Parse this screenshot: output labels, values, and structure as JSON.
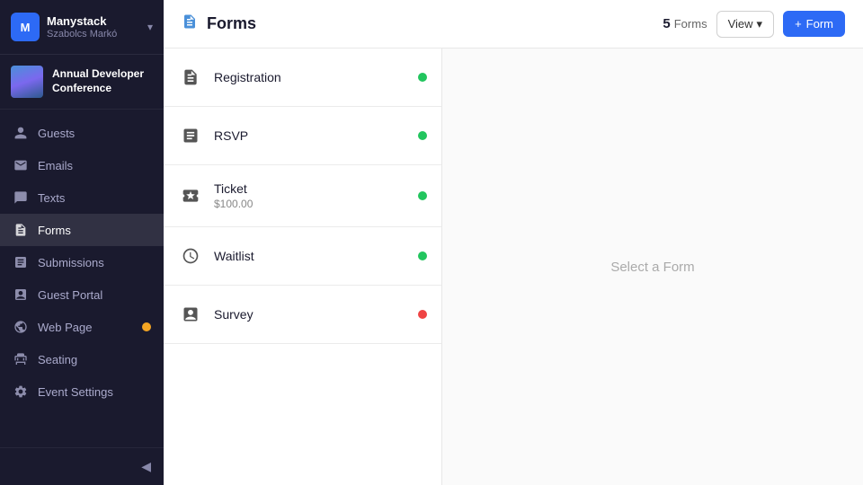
{
  "app": {
    "name": "Manystack",
    "user": "Szabolcs Markó",
    "logo_initials": "M"
  },
  "event": {
    "name": "Annual Developer Conference",
    "thumb_alt": "event thumbnail"
  },
  "nav": {
    "items": [
      {
        "id": "guests",
        "label": "Guests",
        "icon": "👤",
        "active": false,
        "badge": false
      },
      {
        "id": "emails",
        "label": "Emails",
        "icon": "✉️",
        "active": false,
        "badge": false
      },
      {
        "id": "texts",
        "label": "Texts",
        "icon": "💬",
        "active": false,
        "badge": false
      },
      {
        "id": "forms",
        "label": "Forms",
        "icon": "📋",
        "active": true,
        "badge": false
      },
      {
        "id": "submissions",
        "label": "Submissions",
        "icon": "🗂️",
        "active": false,
        "badge": false
      },
      {
        "id": "guest-portal",
        "label": "Guest Portal",
        "icon": "🚪",
        "active": false,
        "badge": false
      },
      {
        "id": "web-page",
        "label": "Web Page",
        "icon": "🌐",
        "active": false,
        "badge": true
      },
      {
        "id": "seating",
        "label": "Seating",
        "icon": "💺",
        "active": false,
        "badge": false
      },
      {
        "id": "event-settings",
        "label": "Event Settings",
        "icon": "⚙️",
        "active": false,
        "badge": false
      }
    ]
  },
  "topbar": {
    "icon": "📋",
    "title": "Forms",
    "forms_count": 5,
    "forms_label": "Forms",
    "view_label": "View",
    "add_form_label": "Form"
  },
  "forms": [
    {
      "id": "registration",
      "name": "Registration",
      "sub": "",
      "icon": "📄",
      "status": "green"
    },
    {
      "id": "rsvp",
      "name": "RSVP",
      "sub": "",
      "icon": "📋",
      "status": "green"
    },
    {
      "id": "ticket",
      "name": "Ticket",
      "sub": "$100.00",
      "icon": "🏷️",
      "status": "green"
    },
    {
      "id": "waitlist",
      "name": "Waitlist",
      "sub": "",
      "icon": "🕐",
      "status": "green"
    },
    {
      "id": "survey",
      "name": "Survey",
      "sub": "",
      "icon": "📊",
      "status": "red"
    }
  ],
  "detail": {
    "placeholder": "Select a Form"
  }
}
